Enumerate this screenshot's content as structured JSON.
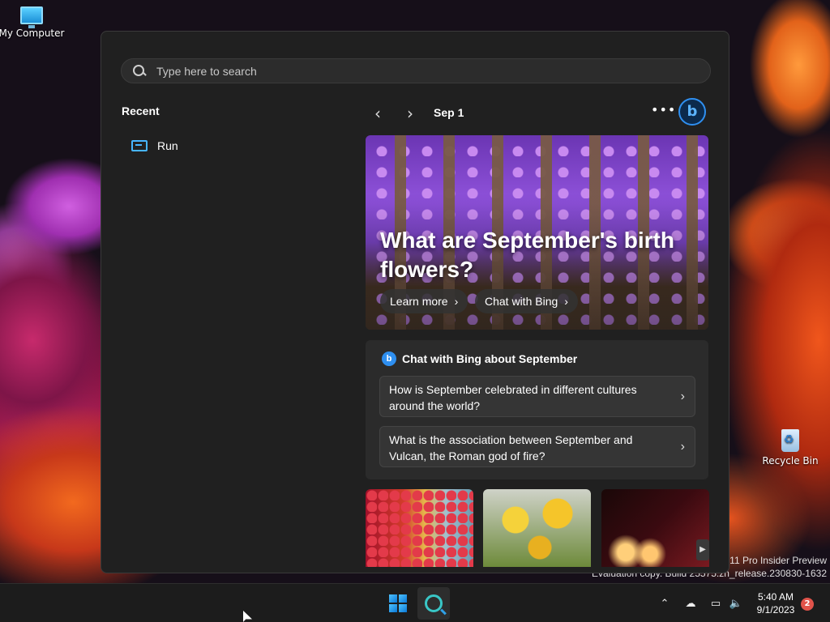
{
  "desktop": {
    "icons": [
      {
        "label": "My Computer",
        "icon": "monitor-icon"
      },
      {
        "label": "Recycle Bin",
        "icon": "recycle-bin-icon"
      }
    ],
    "watermark": {
      "line1": "s 11 Pro Insider Preview",
      "line2": "Evaluation copy. Build 25575.zn_release.230830-1632"
    }
  },
  "search": {
    "placeholder": "Type here to search",
    "value": ""
  },
  "recent": {
    "title": "Recent",
    "items": [
      {
        "label": "Run",
        "icon": "run-icon"
      }
    ]
  },
  "nav": {
    "date": "Sep 1",
    "prev_icon": "chevron-left-icon",
    "next_icon": "chevron-right-icon",
    "more_label": "•••",
    "bing_label": "b"
  },
  "hero": {
    "title": "What are September's birth flowers?",
    "buttons": [
      {
        "label": "Learn more"
      },
      {
        "label": "Chat with Bing"
      }
    ]
  },
  "chat": {
    "title": "Chat with Bing about September",
    "questions": [
      {
        "text": "How is September celebrated in different cultures around the world?"
      },
      {
        "text": "What is the association between September and Vulcan, the Roman god of fire?"
      }
    ]
  },
  "taskbar": {
    "clock_time": "5:40 AM",
    "clock_date": "9/1/2023",
    "notification_count": "2",
    "tray_icons": [
      "chevron-up-icon",
      "cloud-offline-icon",
      "network-icon",
      "volume-icon"
    ]
  },
  "colors": {
    "panel_bg": "#202020",
    "accent": "#2f8ff0",
    "notif_badge": "#e0534a"
  }
}
